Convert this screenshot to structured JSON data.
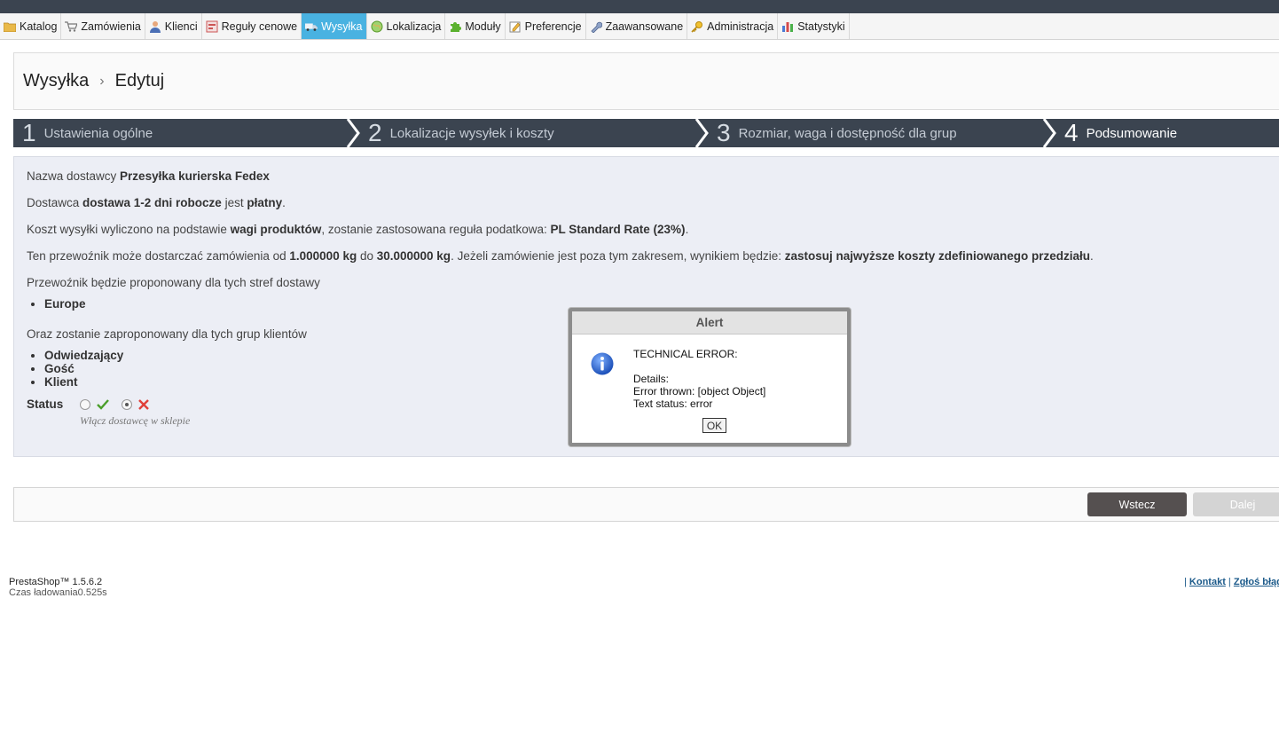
{
  "menu": {
    "items": [
      {
        "label": "Katalog",
        "icon": "folder-icon"
      },
      {
        "label": "Zamówienia",
        "icon": "cart-icon"
      },
      {
        "label": "Klienci",
        "icon": "user-icon"
      },
      {
        "label": "Reguły cenowe",
        "icon": "price-rules-icon"
      },
      {
        "label": "Wysyłka",
        "icon": "truck-icon",
        "active": true
      },
      {
        "label": "Lokalizacja",
        "icon": "globe-icon"
      },
      {
        "label": "Moduły",
        "icon": "puzzle-icon"
      },
      {
        "label": "Preferencje",
        "icon": "preferences-icon"
      },
      {
        "label": "Zaawansowane",
        "icon": "wrench-icon"
      },
      {
        "label": "Administracja",
        "icon": "key-icon"
      },
      {
        "label": "Statystyki",
        "icon": "bar-chart-icon"
      }
    ]
  },
  "breadcrumb": {
    "section": "Wysyłka",
    "separator": "›",
    "page": "Edytuj"
  },
  "steps": [
    {
      "num": "1",
      "label": "Ustawienia ogólne"
    },
    {
      "num": "2",
      "label": "Lokalizacje wysyłek i koszty"
    },
    {
      "num": "3",
      "label": "Rozmiar, waga i dostępność dla grup"
    },
    {
      "num": "4",
      "label": "Podsumowanie",
      "current": true
    }
  ],
  "summary": {
    "carrier_prefix": "Nazwa dostawcy ",
    "carrier_name": "Przesyłka kurierska Fedex",
    "delay_prefix": "Dostawca ",
    "delay": "dostawa 1-2 dni robocze",
    "delay_mid": " jest ",
    "paid": "płatny",
    "delay_end": ".",
    "cost_prefix": "Koszt wysyłki wyliczono na podstawie ",
    "cost_basis": "wagi produktów",
    "cost_mid": ", zostanie zastosowana reguła podatkowa: ",
    "tax_rule": "PL Standard Rate (23%)",
    "cost_end": ".",
    "range_prefix": "Ten przewoźnik może dostarczać zamówienia od ",
    "range_from": "1.000000 kg",
    "range_mid": " do ",
    "range_to": "30.000000 kg",
    "range_mid2": ". Jeżeli zamówienie jest poza tym zakresem, wynikiem będzie: ",
    "out_of_range": "zastosuj najwyższe koszty zdefiniowanego przedziału",
    "range_end": ".",
    "zones_intro": "Przewoźnik będzie proponowany dla tych stref dostawy",
    "zones": [
      "Europe"
    ],
    "groups_intro": "Oraz zostanie zaproponowany dla tych grup klientów",
    "groups": [
      "Odwiedzający",
      "Gość",
      "Klient"
    ],
    "status_label": "Status",
    "status_hint": "Włącz dostawcę w sklepie",
    "status_enabled": false
  },
  "buttons": {
    "back": "Wstecz",
    "next": "Dalej"
  },
  "footer": {
    "version": "PrestaShop™ 1.5.6.2",
    "load_time": "Czas ładowania0.525s",
    "sep1": "| ",
    "contact": "Kontakt",
    "sep2": " | ",
    "report": "Zgłoś błąd"
  },
  "alert": {
    "title": "Alert",
    "message": "TECHNICAL ERROR: \n\nDetails:\nError thrown: [object Object]\nText status: error",
    "ok": "OK",
    "icon": "info-icon"
  },
  "colors": {
    "active_tab": "#49b2e1",
    "steps_bg": "#3b4450",
    "summary_bg": "#eceef5"
  }
}
